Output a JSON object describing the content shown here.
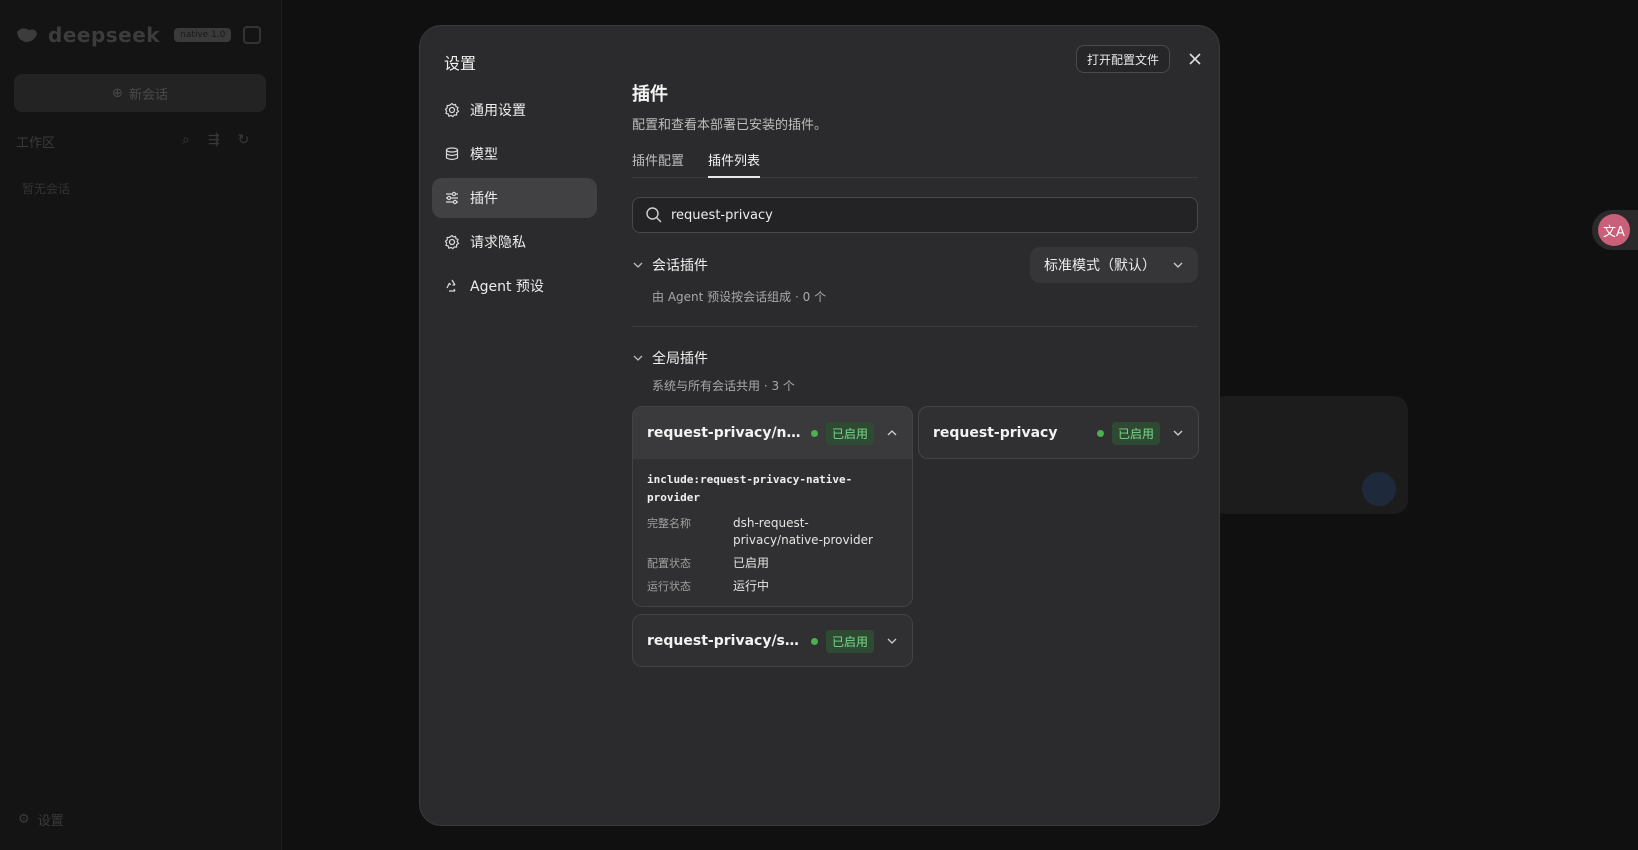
{
  "background": {
    "brand_name": "deepseek",
    "brand_badge": "native 1.0",
    "new_chat_label": "新会话",
    "workspace_label": "工作区",
    "empty_label": "暂无会话",
    "bottom_settings_label": "设置"
  },
  "modal": {
    "title": "设置",
    "open_config_label": "打开配置文件"
  },
  "nav": {
    "items": [
      {
        "label": "通用设置",
        "icon": "gear-icon"
      },
      {
        "label": "模型",
        "icon": "database-icon"
      },
      {
        "label": "插件",
        "icon": "sliders-icon",
        "active": true
      },
      {
        "label": "请求隐私",
        "icon": "gear-icon"
      },
      {
        "label": "Agent 预设",
        "icon": "recycle-icon"
      }
    ]
  },
  "main": {
    "title": "插件",
    "description": "配置和查看本部署已安装的插件。",
    "tabs": [
      {
        "label": "插件配置",
        "active": false
      },
      {
        "label": "插件列表",
        "active": true
      }
    ],
    "search_value": "request-privacy",
    "session_section": {
      "title": "会话插件",
      "subtitle": "由 Agent 预设按会话组成",
      "count": "· 0 个",
      "mode_select": "标准模式（默认）"
    },
    "global_section": {
      "title": "全局插件",
      "subtitle": "系统与所有会话共用",
      "count": "· 3 个"
    },
    "plugins": [
      {
        "name": "request-privacy/native...",
        "status": "已启用",
        "expanded": true,
        "include": "include:request-privacy-native-provider",
        "details": [
          {
            "key": "完整名称",
            "value": "dsh-request-privacy/native-provider"
          },
          {
            "key": "配置状态",
            "value": "已启用"
          },
          {
            "key": "运行状态",
            "value": "运行中"
          }
        ]
      },
      {
        "name": "request-privacy",
        "status": "已启用",
        "expanded": false
      },
      {
        "name": "request-privacy/setting...",
        "status": "已启用",
        "expanded": false
      }
    ]
  },
  "colors": {
    "modal_bg": "#2b2b2d",
    "active_nav": "#414144",
    "status_green": "#4caf50",
    "badge_bg": "#2f4a33",
    "translate_fab": "#c9607a"
  }
}
